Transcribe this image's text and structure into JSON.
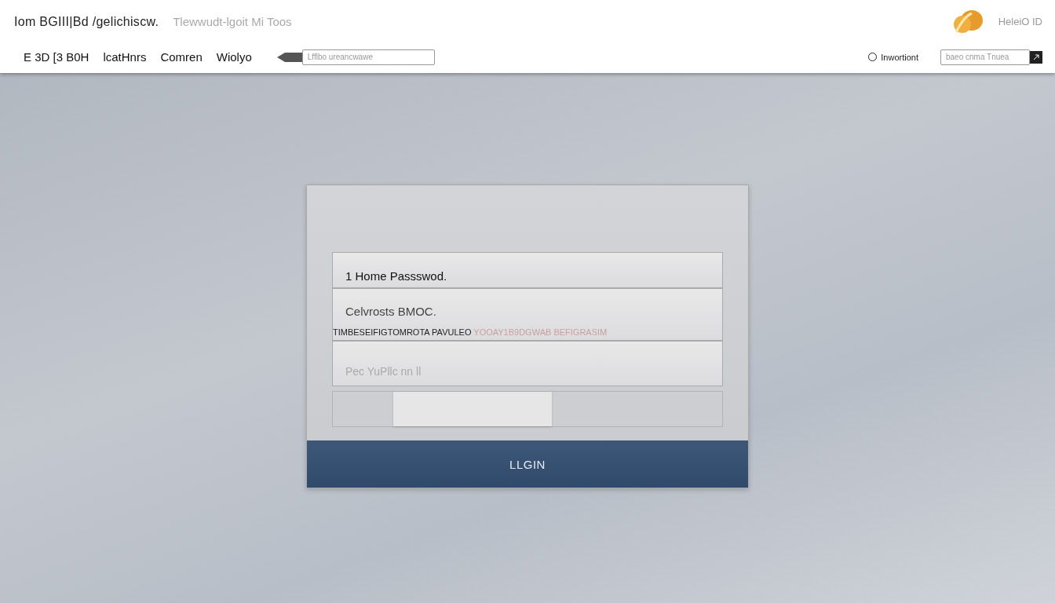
{
  "header": {
    "title": "Iom BGIII|Bd /gelichiscw.",
    "subtitle": "Tlewwudt-lgoit Mi  Toos",
    "brand_text": "HeleiO ID",
    "nav": [
      "E 3D [3 B0H",
      "lcatHnrs",
      "Comren",
      "Wiolyo"
    ],
    "address_field": {
      "placeholder": "Lfflbo ureancwawe"
    },
    "option": {
      "label": "Inwortiont",
      "selected": false
    },
    "search": {
      "placeholder": "baeo cnma Tnuea"
    }
  },
  "login": {
    "fields": [
      {
        "kind": "value",
        "value": "1 Home Passswod."
      },
      {
        "kind": "value",
        "value": "Celvrosts BMOC.",
        "note": "TIMBESEIFIGTOMROTA PAVULEO",
        "note_extra": "YOOAY1B9DGWAB BEFIGRASIM"
      },
      {
        "kind": "placeholder",
        "placeholder": "Pec YuPllc nn ll"
      }
    ],
    "submit": "LLGIN"
  }
}
